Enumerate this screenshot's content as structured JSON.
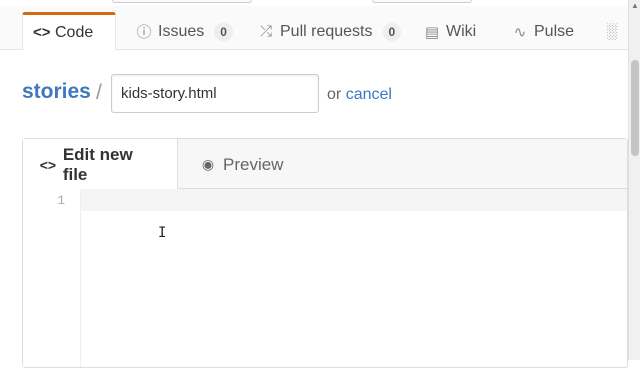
{
  "repo_nav": {
    "tabs": [
      {
        "label": "Code",
        "icon": "code-icon",
        "active": true
      },
      {
        "label": "Issues",
        "icon": "issue-icon",
        "count": "0"
      },
      {
        "label": "Pull requests",
        "icon": "pull-request-icon",
        "count": "0"
      },
      {
        "label": "Wiki",
        "icon": "book-icon"
      },
      {
        "label": "Pulse",
        "icon": "pulse-icon"
      },
      {
        "label": "",
        "icon": "graph-icon"
      }
    ]
  },
  "breadcrumb": {
    "repo": "stories",
    "separator": "/"
  },
  "filename": {
    "value": "kids-story.html"
  },
  "actions": {
    "or_text": "or",
    "cancel_label": "cancel"
  },
  "editor": {
    "tabs": [
      {
        "label": "Edit new file",
        "icon": "code-icon",
        "active": true
      },
      {
        "label": "Preview",
        "icon": "eye-icon"
      }
    ],
    "line_numbers": [
      "1"
    ]
  },
  "colors": {
    "link": "#4078c0",
    "active_tab_accent": "#d26911"
  }
}
